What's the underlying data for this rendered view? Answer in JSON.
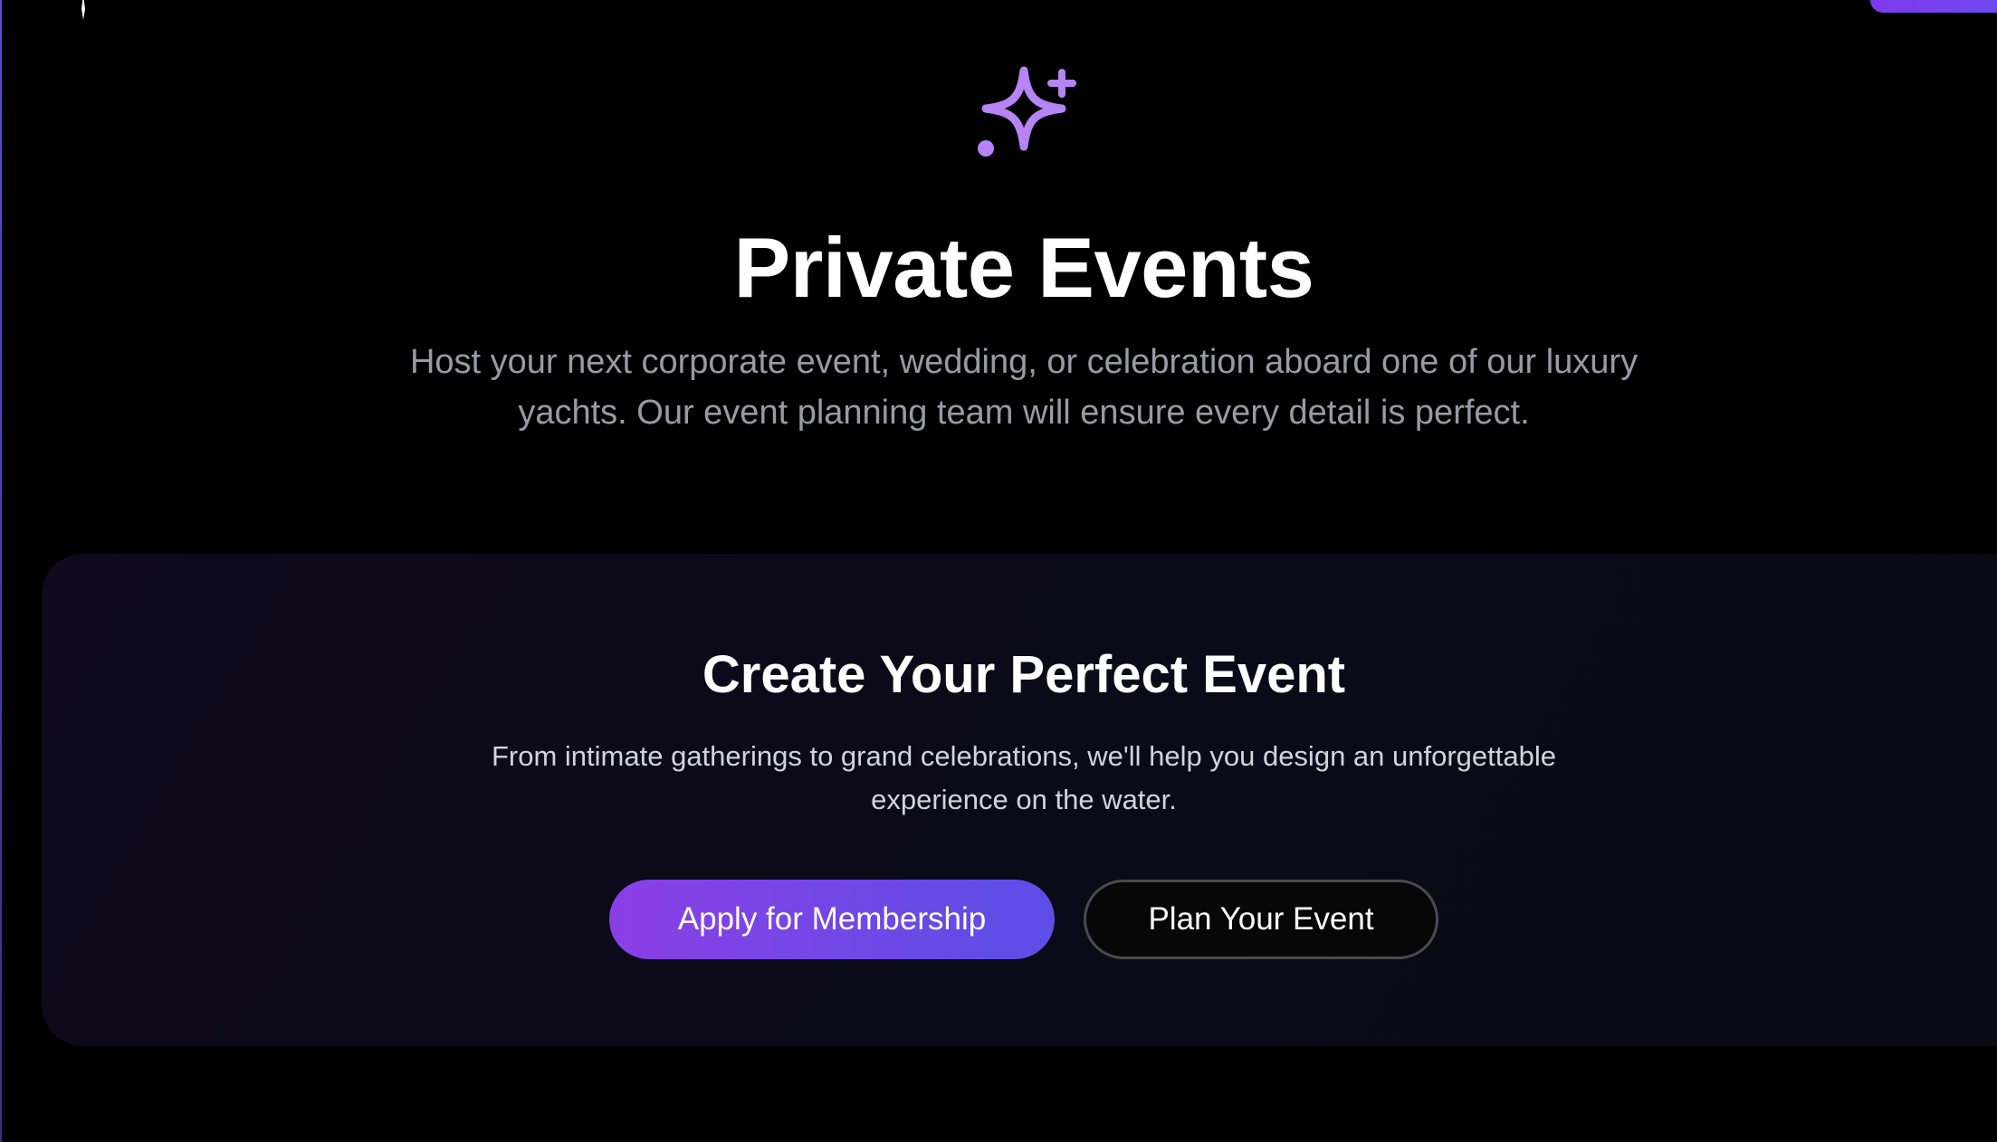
{
  "hero": {
    "icon": "sparkles-icon",
    "title": "Private Events",
    "description": "Host your next corporate event, wedding, or celebration aboard one of our luxury yachts. Our event planning team will ensure every detail is perfect."
  },
  "cta": {
    "title": "Create Your Perfect Event",
    "description": "From intimate gatherings to grand celebrations, we'll help you design an unforgettable experience on the water.",
    "primary_button": "Apply for Membership",
    "secondary_button": "Plan Your Event"
  },
  "colors": {
    "background": "#000000",
    "accent_purple": "#8b3fe6",
    "accent_indigo": "#5b4ee6",
    "icon_purple": "#b684f5",
    "card_background": "#0c0a1a"
  }
}
